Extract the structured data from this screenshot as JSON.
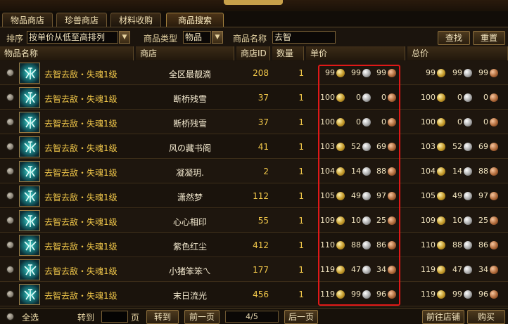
{
  "tabs": [
    "物品商店",
    "珍兽商店",
    "材料收购",
    "商品搜索"
  ],
  "filter": {
    "sort_label": "排序",
    "sort_value": "按单价从低至高排列",
    "type_label": "商品类型",
    "type_value": "物品",
    "name_label": "商品名称",
    "name_value": "去智",
    "search_button": "查找",
    "reset_button": "重置"
  },
  "columns": {
    "item_name": "物品名称",
    "shop": "商店",
    "shop_id": "商店ID",
    "qty": "数量",
    "unit_price": "单价",
    "total_price": "总价"
  },
  "rows": [
    {
      "item": "去智去敌・失魂1级",
      "shop": "全区最靓滴",
      "shop_id": "208",
      "qty": "1",
      "unit": [
        "99",
        "99",
        "99"
      ],
      "total": [
        "99",
        "99",
        "99"
      ]
    },
    {
      "item": "去智去敌・失魂1级",
      "shop": "断桥残雪",
      "shop_id": "37",
      "qty": "1",
      "unit": [
        "100",
        "0",
        "0"
      ],
      "total": [
        "100",
        "0",
        "0"
      ]
    },
    {
      "item": "去智去敌・失魂1级",
      "shop": "断桥残雪",
      "shop_id": "37",
      "qty": "1",
      "unit": [
        "100",
        "0",
        "0"
      ],
      "total": [
        "100",
        "0",
        "0"
      ]
    },
    {
      "item": "去智去敌・失魂1级",
      "shop": "风の藏书阁",
      "shop_id": "41",
      "qty": "1",
      "unit": [
        "103",
        "52",
        "69"
      ],
      "total": [
        "103",
        "52",
        "69"
      ]
    },
    {
      "item": "去智去敌・失魂1级",
      "shop": "凝凝玥.",
      "shop_id": "2",
      "qty": "1",
      "unit": [
        "104",
        "14",
        "88"
      ],
      "total": [
        "104",
        "14",
        "88"
      ]
    },
    {
      "item": "去智去敌・失魂1级",
      "shop": "潇然梦",
      "shop_id": "112",
      "qty": "1",
      "unit": [
        "105",
        "49",
        "97"
      ],
      "total": [
        "105",
        "49",
        "97"
      ]
    },
    {
      "item": "去智去敌・失魂1级",
      "shop": "心心相印",
      "shop_id": "55",
      "qty": "1",
      "unit": [
        "109",
        "10",
        "25"
      ],
      "total": [
        "109",
        "10",
        "25"
      ]
    },
    {
      "item": "去智去敌・失魂1级",
      "shop": "紫色红尘",
      "shop_id": "412",
      "qty": "1",
      "unit": [
        "110",
        "88",
        "86"
      ],
      "total": [
        "110",
        "88",
        "86"
      ]
    },
    {
      "item": "去智去敌・失魂1级",
      "shop": "小猪笨笨ㄟ",
      "shop_id": "177",
      "qty": "1",
      "unit": [
        "119",
        "47",
        "34"
      ],
      "total": [
        "119",
        "47",
        "34"
      ]
    },
    {
      "item": "去智去敌・失魂1级",
      "shop": "末日流光",
      "shop_id": "456",
      "qty": "1",
      "unit": [
        "119",
        "99",
        "96"
      ],
      "total": [
        "119",
        "99",
        "96"
      ]
    }
  ],
  "footer": {
    "select_all": "全选",
    "goto_label": "转到",
    "page_unit": "页",
    "goto_button": "转到",
    "prev_button": "前一页",
    "page_indicator": "4/5",
    "next_button": "后一页",
    "go_shop_button": "前往店铺",
    "buy_button": "购买"
  },
  "icons": {
    "item_icon": "item-rune-icon",
    "coin_gold": "gold-coin-icon",
    "coin_silver": "silver-coin-icon",
    "coin_copper": "copper-coin-icon",
    "dropdown": "chevron-down-icon",
    "radio": "radio-button-icon"
  },
  "colors": {
    "highlight": "#e01818",
    "item_name": "#f2c84a",
    "background": "#1b140d"
  }
}
